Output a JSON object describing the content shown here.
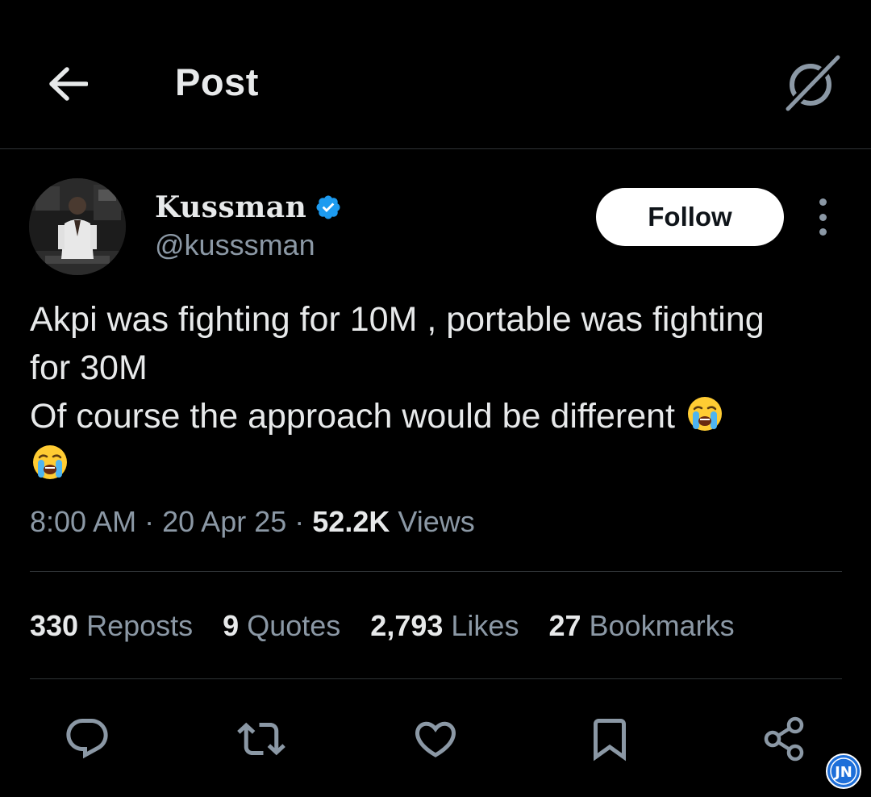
{
  "header": {
    "title": "Post",
    "back_icon": "arrow-left-icon",
    "grok_icon": "grok-icon"
  },
  "author": {
    "display_name": "Kussman",
    "handle": "@kusssman",
    "verified": true,
    "verified_color": "#1d9bf0",
    "follow_label": "Follow"
  },
  "post": {
    "lines": [
      "Akpi was fighting for 10M , portable was fighting",
      "for 30M",
      "Of course the approach would be different"
    ],
    "emoji": "loudly-crying-face"
  },
  "meta": {
    "time": "8:00 AM",
    "separator": "·",
    "date": "20 Apr 25",
    "views_count": "52.2K",
    "views_label": "Views"
  },
  "stats": {
    "reposts": {
      "count": "330",
      "label": "Reposts"
    },
    "quotes": {
      "count": "9",
      "label": "Quotes"
    },
    "likes": {
      "count": "2,793",
      "label": "Likes"
    },
    "bookmarks": {
      "count": "27",
      "label": "Bookmarks"
    }
  },
  "actions": [
    "reply-icon",
    "repost-icon",
    "like-icon",
    "bookmark-icon",
    "share-icon"
  ],
  "watermark": {
    "text": "JN",
    "color": "#1e6fd9"
  },
  "colors": {
    "background": "#000000",
    "text_primary": "#e7e9ea",
    "text_secondary": "#8b98a5",
    "divider": "#2f3336"
  }
}
